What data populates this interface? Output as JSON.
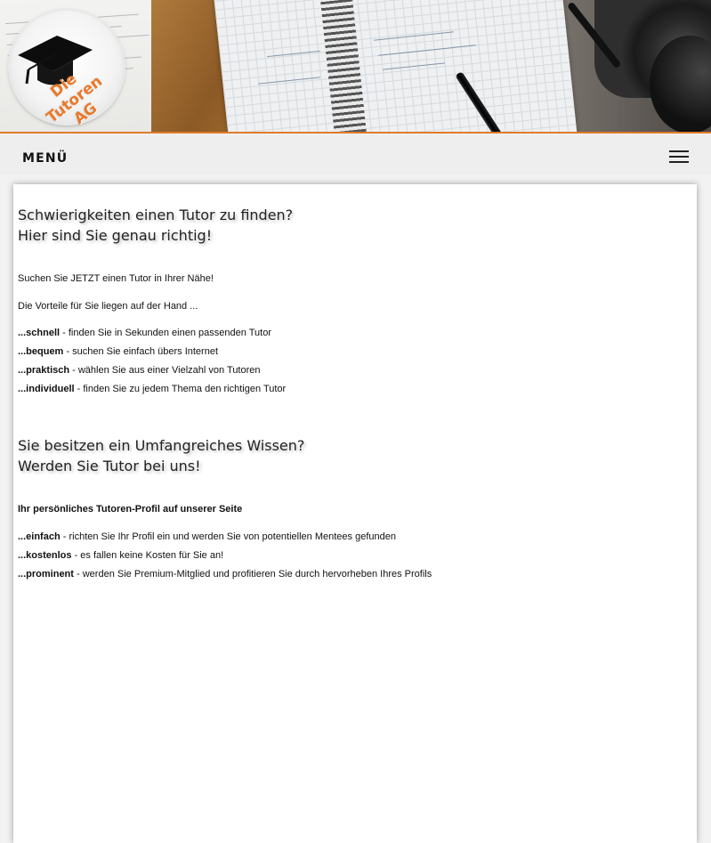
{
  "logo": {
    "text": "Die Tutoren AG"
  },
  "menu": {
    "label": "MENÜ"
  },
  "section1": {
    "heading_line1": "Schwierigkeiten einen Tutor zu finden?",
    "heading_line2": "Hier sind Sie genau richtig!",
    "intro": "Suchen Sie JETZT einen Tutor in Ihrer Nähe!",
    "lead": "Die Vorteile für Sie liegen auf der Hand ...",
    "items": [
      {
        "key": "...schnell",
        "text": " - finden Sie in Sekunden einen passenden Tutor"
      },
      {
        "key": "...bequem",
        "text": " - suchen Sie einfach übers Internet"
      },
      {
        "key": "...praktisch",
        "text": " - wählen Sie aus einer Vielzahl von Tutoren"
      },
      {
        "key": "...individuell",
        "text": " - finden Sie zu jedem Thema den richtigen Tutor"
      }
    ]
  },
  "section2": {
    "heading_line1": "Sie besitzen ein Umfangreiches Wissen?",
    "heading_line2": "Werden Sie Tutor bei uns!",
    "subtitle": "Ihr persönliches Tutoren-Profil auf unserer Seite",
    "items": [
      {
        "key": "...einfach",
        "text": " - richten Sie Ihr Profil ein und werden Sie von potentiellen Mentees gefunden"
      },
      {
        "key": "...kostenlos",
        "text": " - es fallen keine Kosten für Sie an!"
      },
      {
        "key": "...prominent",
        "text": " - werden Sie Premium-Mitglied und profitieren Sie durch hervorheben Ihres Profils"
      }
    ]
  },
  "colors": {
    "accent": "#e07b2a",
    "menubar": "#eeeeee",
    "page_bg": "#f2f2f2"
  },
  "icons": {
    "menu": "hamburger-icon",
    "logo": "graduation-cap-icon"
  }
}
